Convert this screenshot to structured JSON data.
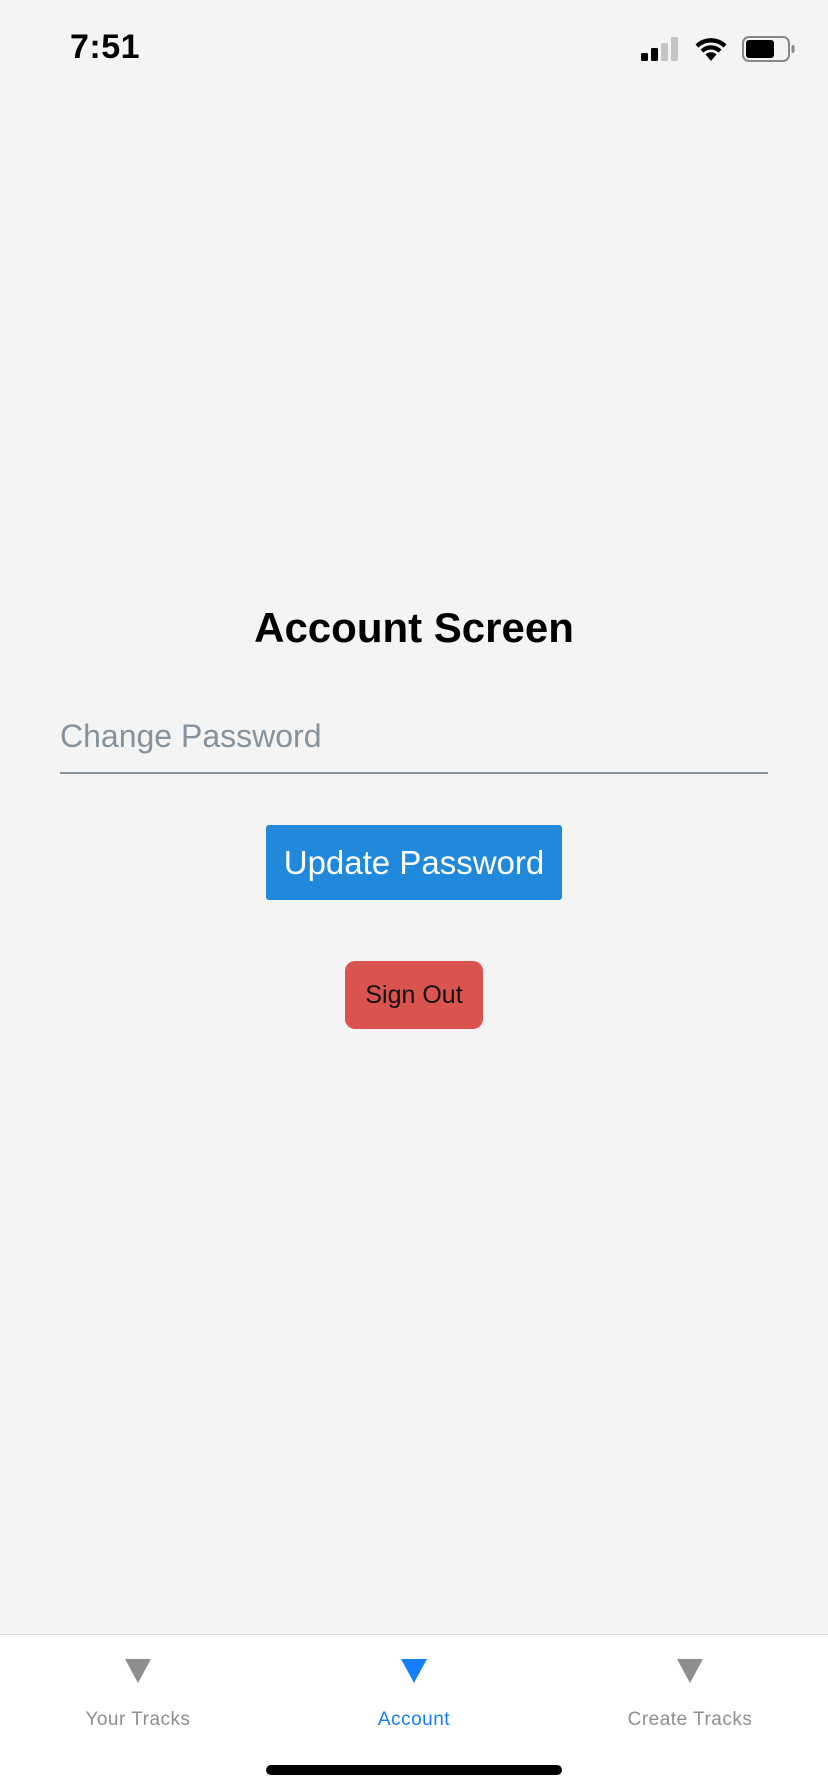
{
  "status_bar": {
    "time": "7:51",
    "signal_icon": "cellular-signal-icon",
    "wifi_icon": "wifi-icon",
    "battery_icon": "battery-icon",
    "battery_level": 0.7
  },
  "screen": {
    "title": "Account Screen",
    "password_input": {
      "placeholder": "Change Password",
      "value": ""
    },
    "update_button_label": "Update Password",
    "signout_button_label": "Sign Out"
  },
  "tab_bar": {
    "active_index": 1,
    "tabs": [
      {
        "label": "Your Tracks",
        "icon": "triangle-down-icon"
      },
      {
        "label": "Account",
        "icon": "triangle-down-icon"
      },
      {
        "label": "Create Tracks",
        "icon": "triangle-down-icon"
      }
    ]
  },
  "colors": {
    "background": "#f4f4f4",
    "primary_button": "#2089dc",
    "danger_button": "#d9534f",
    "tab_active": "#147efb",
    "tab_inactive": "#8e8e8e",
    "input_underline": "#86939e"
  }
}
